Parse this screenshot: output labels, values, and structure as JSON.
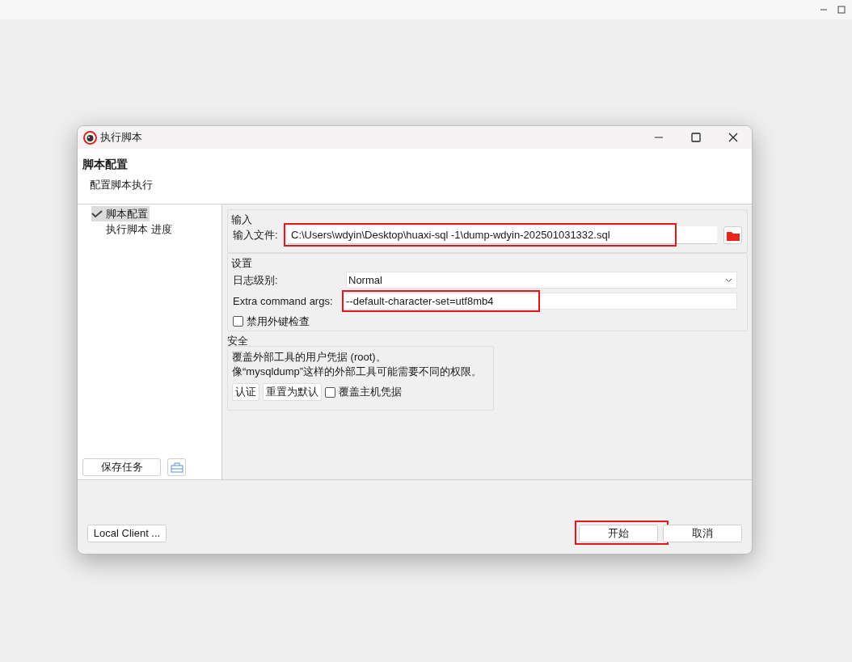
{
  "window": {
    "title": "执行脚本"
  },
  "header": {
    "title": "脚本配置",
    "subtitle": "配置脚本执行"
  },
  "nav": {
    "items": [
      {
        "label": "脚本配置",
        "selected": true,
        "checked": true
      },
      {
        "label": "执行脚本 进度",
        "selected": false,
        "checked": false
      }
    ]
  },
  "save_button": "保存任务",
  "input_section": {
    "title": "输入",
    "file_label": "输入文件:",
    "file_value": "C:\\Users\\wdyin\\Desktop\\huaxi-sql -1\\dump-wdyin-202501031332.sql",
    "highlighted": true
  },
  "settings": {
    "title": "设置",
    "log_level_label": "日志级别:",
    "log_level_value": "Normal",
    "extra_args_label": "Extra command args:",
    "extra_args_value": "--default-character-set=utf8mb4",
    "extra_args_highlighted": true,
    "disable_fk_check": {
      "label": "禁用外键检查",
      "checked": false
    }
  },
  "security": {
    "title": "安全",
    "lines": [
      "覆盖外部工具的用户凭据 (root)。",
      "像“mysqldump”这样的外部工具可能需要不同的权限。"
    ],
    "buttons": [
      "认证",
      "重置为默认"
    ],
    "override_host": {
      "label": "覆盖主机凭据",
      "checked": false
    }
  },
  "footer": {
    "client_button": "Local Client ...",
    "buttons": [
      {
        "label": "开始",
        "highlighted": true
      },
      {
        "label": "取消",
        "highlighted": false
      }
    ]
  }
}
